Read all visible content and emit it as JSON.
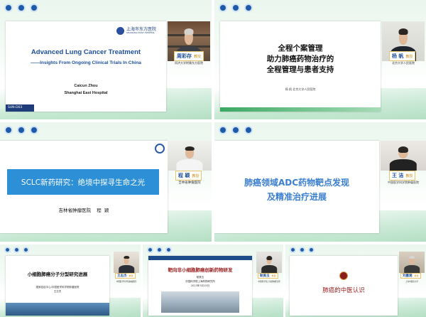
{
  "tiles": [
    {
      "slide": {
        "logo_text": "上海市东方医院",
        "logo_sub": "SHANGHAI EAST HOSPITAL",
        "title": "Advanced Lung Cancer Treatment",
        "subtitle": "——Insights From Ongoing Clinical Trials In China",
        "author": "Caicun Zhou",
        "institution": "Shanghai East Hospital",
        "footer_tag": "SUN-D03"
      },
      "speaker": {
        "name": "周彩存",
        "title": "教授",
        "affiliation": "同济大学附属东方医院"
      }
    },
    {
      "slide": {
        "line1": "全程个案管理",
        "line2": "助力肺癌药物治疗的",
        "line3": "全程管理与患者支持",
        "byline": "杨  帆  北京大学人民医院"
      },
      "speaker": {
        "name": "杨  帆",
        "title": "教授",
        "affiliation": "北京大学人民医院"
      }
    },
    {
      "slide": {
        "banner": "SCLC新药研究：绝境中探寻生命之光",
        "byline": "吉林省肿瘤医院    程  颖"
      },
      "speaker": {
        "name": "程  颖",
        "title": "教授",
        "affiliation": "吉林省肿瘤医院"
      }
    },
    {
      "slide": {
        "line1": "肺癌领域ADC药物靶点发现",
        "line2": "及精准治疗进展"
      },
      "speaker": {
        "name": "王  洁",
        "title": "教授",
        "affiliation": "中国医学科学院肿瘤医院"
      }
    },
    {
      "slide": {
        "title": "小细胞肺癌分子分型研究进展",
        "sub1": "国家癌症中心/中国医学科学院肿瘤医院",
        "sub2": "王志杰"
      },
      "speaker": {
        "name": "王志杰",
        "title": "教授",
        "affiliation": "中国医学科学院肿瘤医院"
      }
    },
    {
      "slide": {
        "title": "靶向非小细胞肺癌创新药物研发",
        "sub1": "耿美玉",
        "sub2": "中国科学院上海药物研究所",
        "sub3": "2023年3月15日"
      },
      "speaker": {
        "name": "耿美玉",
        "title": "教授",
        "affiliation": "中国科学院上海药物研究所"
      }
    },
    {
      "slide": {
        "title": "肺癌的中医认识"
      },
      "speaker": {
        "name": "刘嘉湘",
        "title": "教授",
        "affiliation": "上海中医药大学"
      }
    }
  ],
  "colors": {
    "accent_blue": "#2d8fd6",
    "title_blue": "#1d4f9a",
    "adc_blue": "#3b7fd0",
    "maroon": "#9b1b1b",
    "nametag_border": "#e8c56a"
  }
}
